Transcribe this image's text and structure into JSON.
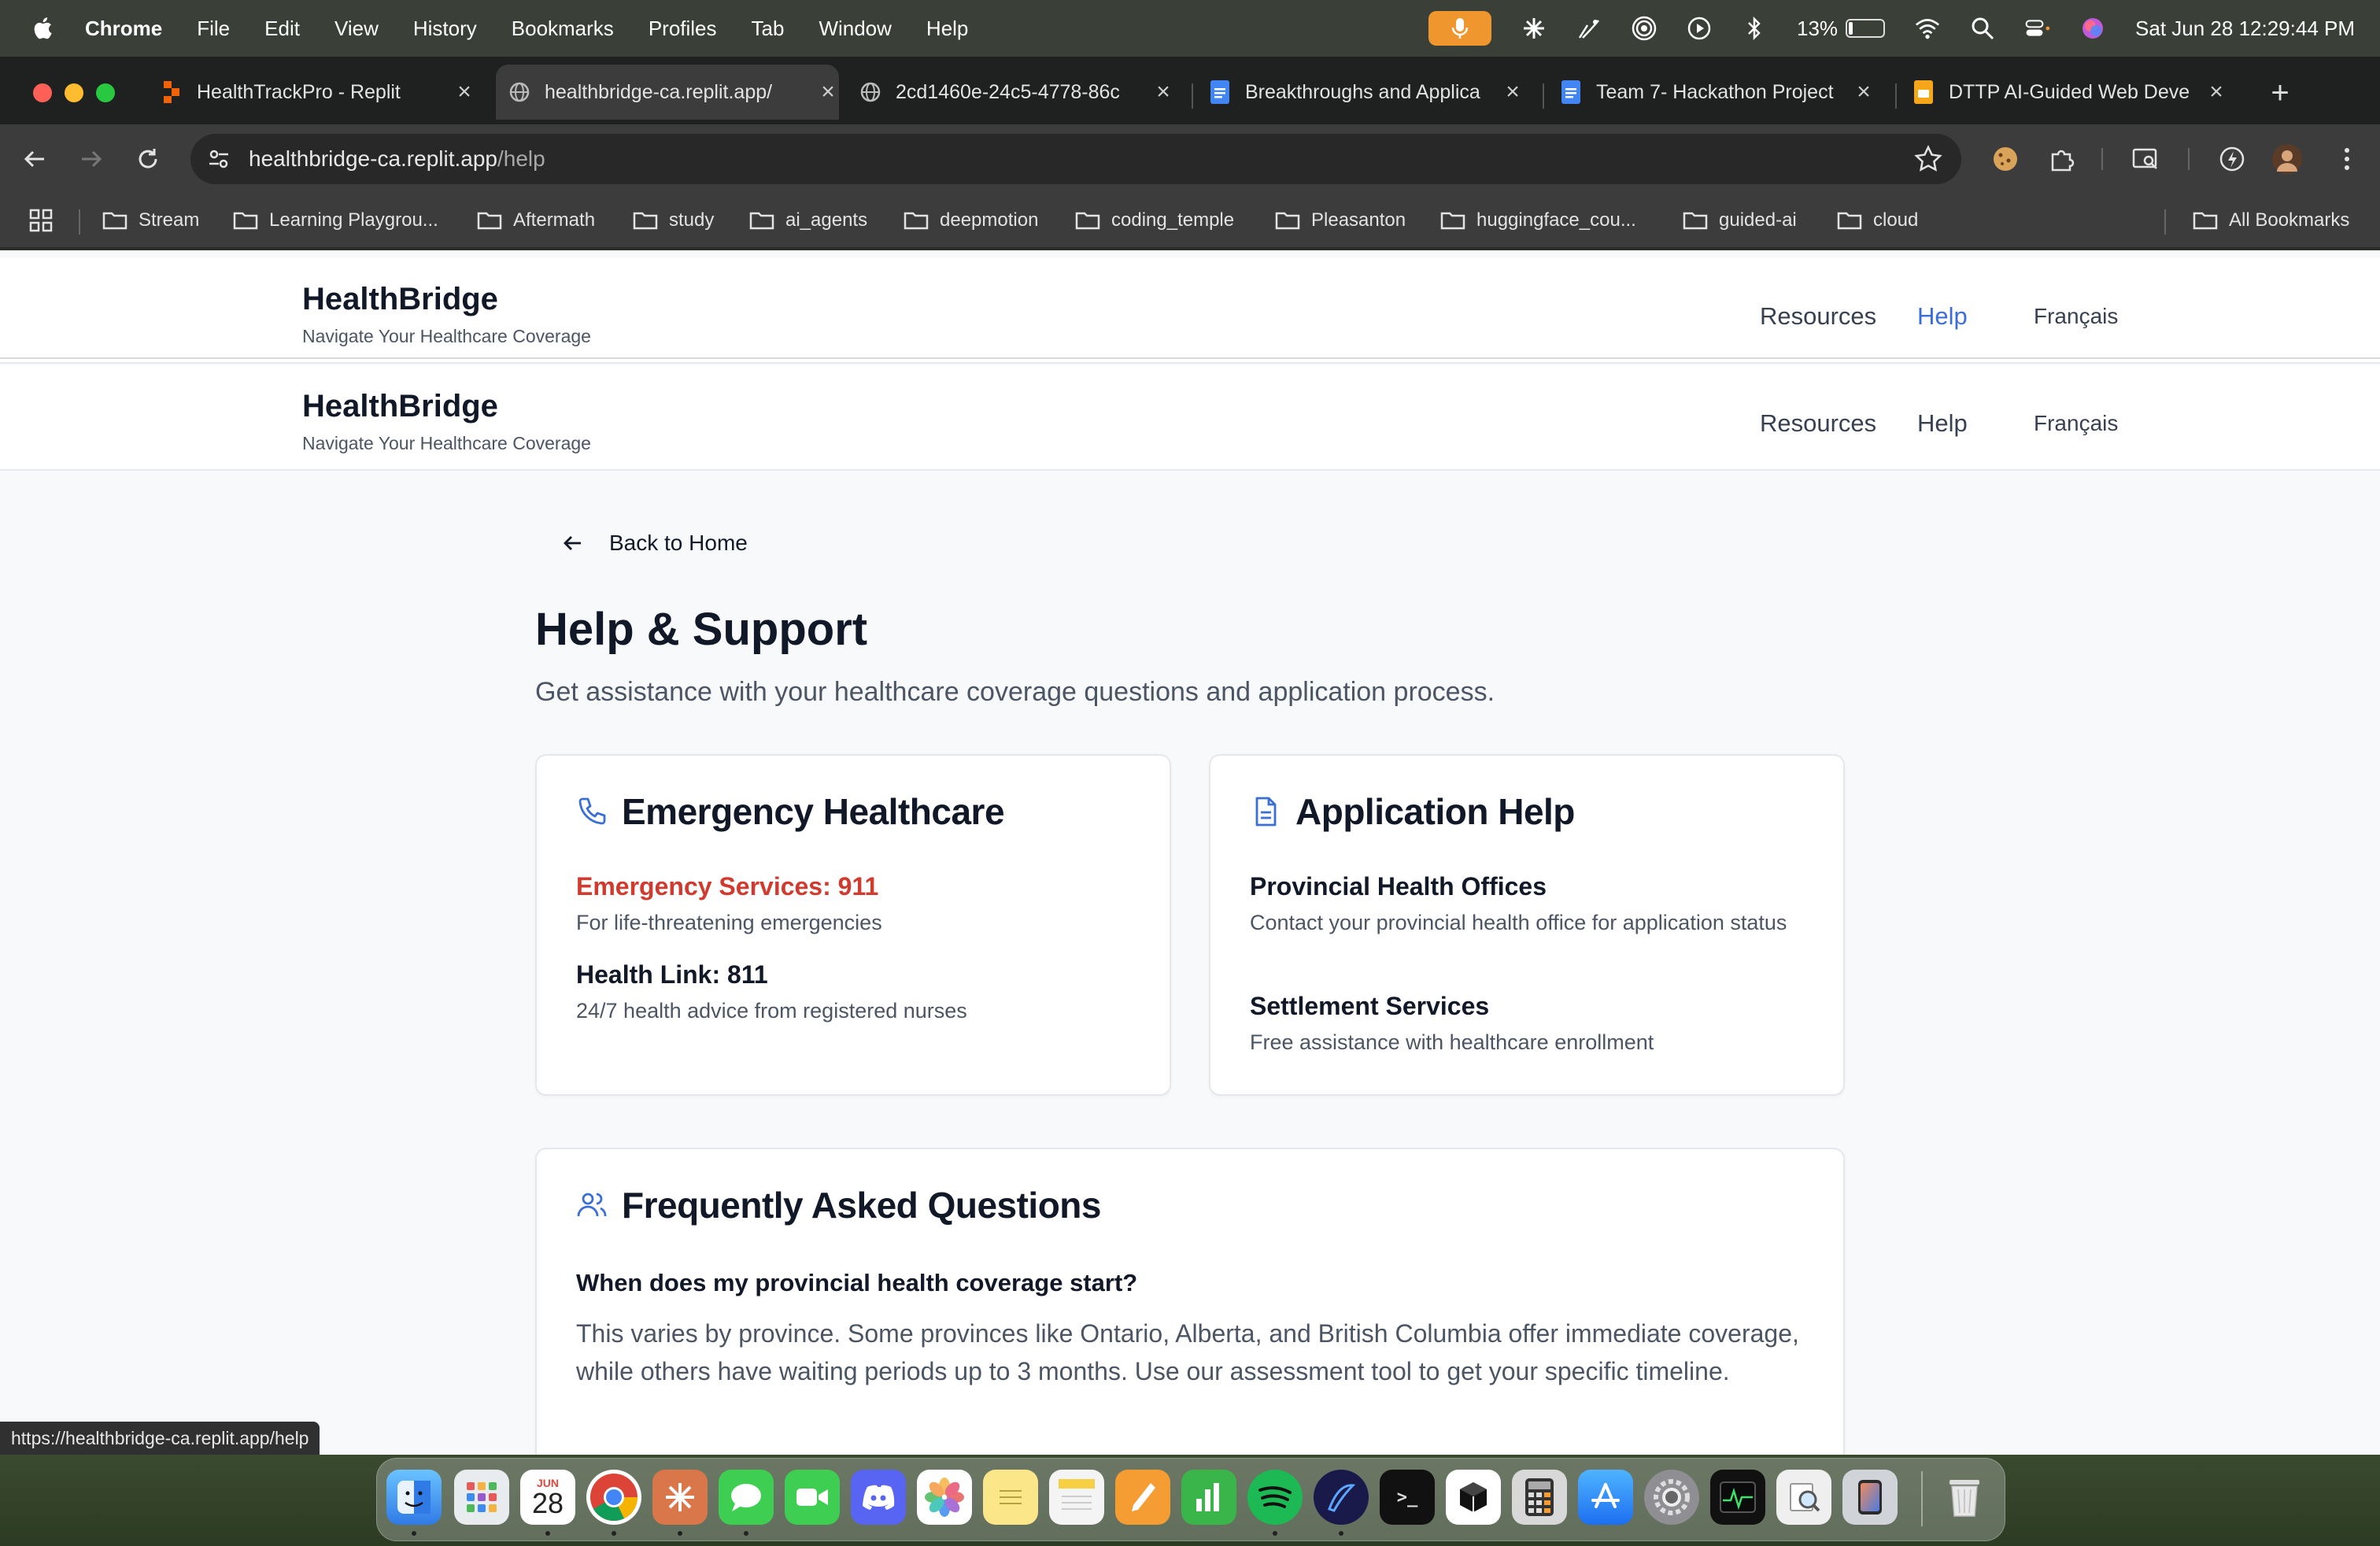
{
  "menubar": {
    "app_name": "Chrome",
    "menus": [
      "File",
      "Edit",
      "View",
      "History",
      "Bookmarks",
      "Profiles",
      "Tab",
      "Window",
      "Help"
    ],
    "battery_percent": "13%",
    "datetime": "Sat Jun 28  12:29:44 PM",
    "battery_level": 0.13
  },
  "tabs": [
    {
      "title": "HealthTrackPro - Replit",
      "icon": "replit-icon"
    },
    {
      "title": "healthbridge-ca.replit.app/",
      "icon": "globe-icon",
      "active": true
    },
    {
      "title": "2cd1460e-24c5-4778-86c",
      "icon": "globe-icon"
    },
    {
      "title": "Breakthroughs and Applica",
      "icon": "docs-icon"
    },
    {
      "title": "Team 7- Hackathon Project",
      "icon": "docs-icon"
    },
    {
      "title": "DTTP AI-Guided Web Deve",
      "icon": "slides-icon"
    }
  ],
  "address": {
    "host": "healthbridge-ca.replit.app",
    "path": "/help"
  },
  "bookmarks": {
    "items": [
      "Stream",
      "Learning Playgrou...",
      "Aftermath",
      "study",
      "ai_agents",
      "deepmotion",
      "coding_temple",
      "Pleasanton",
      "huggingface_cou...",
      "guided-ai",
      "cloud"
    ],
    "all_label": "All Bookmarks"
  },
  "site": {
    "brand": "HealthBridge",
    "tagline": "Navigate Your Healthcare Coverage",
    "nav": {
      "resources": "Resources",
      "help": "Help",
      "language": "Français"
    }
  },
  "page": {
    "back": "Back to Home",
    "title": "Help & Support",
    "subtitle": "Get assistance with your healthcare coverage questions and application process.",
    "emergency": {
      "title": "Emergency Healthcare",
      "items": [
        {
          "title": "Emergency Services: 911",
          "desc": "For life-threatening emergencies"
        },
        {
          "title": "Health Link: 811",
          "desc": "24/7 health advice from registered nurses"
        }
      ]
    },
    "application": {
      "title": "Application Help",
      "items": [
        {
          "title": "Provincial Health Offices",
          "desc": "Contact your provincial health office for application status"
        },
        {
          "title": "Settlement Services",
          "desc": "Free assistance with healthcare enrollment"
        }
      ]
    },
    "faq": {
      "title": "Frequently Asked Questions",
      "items": [
        {
          "q": "When does my provincial health coverage start?",
          "a": "This varies by province. Some provinces like Ontario, Alberta, and British Columbia offer immediate coverage, while others have waiting periods up to 3 months. Use our assessment tool to get your specific timeline."
        }
      ]
    }
  },
  "status_bar": {
    "url": "https://healthbridge-ca.replit.app/help"
  },
  "dock": {
    "calendar_month": "JUN",
    "calendar_day": "28"
  },
  "colors": {
    "accent": "#3b6fd6",
    "emergency": "#d03a2f",
    "mic": "#f0962e"
  }
}
